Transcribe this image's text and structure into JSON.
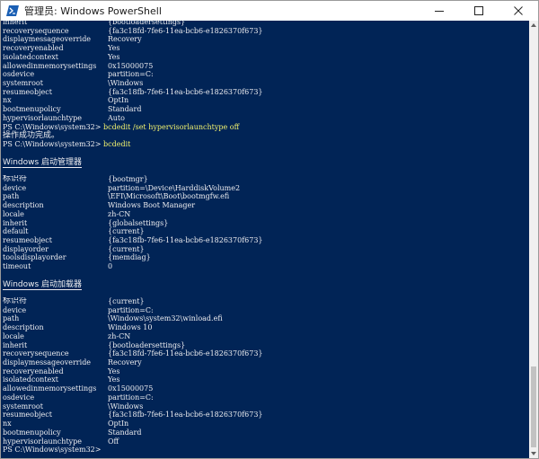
{
  "window": {
    "title": "管理员: Windows PowerShell"
  },
  "console": {
    "lines": [
      {
        "type": "kv",
        "key": "inherit",
        "value": "{bootloadersettings}"
      },
      {
        "type": "kv",
        "key": "recoverysequence",
        "value": "{fa3c18fd-7fe6-11ea-bcb6-e1826370f673}"
      },
      {
        "type": "kv",
        "key": "displaymessageoverride",
        "value": "Recovery"
      },
      {
        "type": "kv",
        "key": "recoveryenabled",
        "value": "Yes"
      },
      {
        "type": "kv",
        "key": "isolatedcontext",
        "value": "Yes"
      },
      {
        "type": "kv",
        "key": "allowedinmemorysettings",
        "value": "0x15000075"
      },
      {
        "type": "kv",
        "key": "osdevice",
        "value": "partition=C:"
      },
      {
        "type": "kv",
        "key": "systemroot",
        "value": "\\Windows"
      },
      {
        "type": "kv",
        "key": "resumeobject",
        "value": "{fa3c18fb-7fe6-11ea-bcb6-e1826370f673}"
      },
      {
        "type": "kv",
        "key": "nx",
        "value": "OptIn"
      },
      {
        "type": "kv",
        "key": "bootmenupolicy",
        "value": "Standard"
      },
      {
        "type": "kv",
        "key": "hypervisorlaunchtype",
        "value": "Auto"
      },
      {
        "type": "prompt",
        "prompt": "PS C:\\Windows\\system32> ",
        "command": "bcdedit /set hypervisorlaunchtype off"
      },
      {
        "type": "text",
        "text": "操作成功完成。"
      },
      {
        "type": "prompt",
        "prompt": "PS C:\\Windows\\system32> ",
        "command": "bcdedit"
      },
      {
        "type": "blank"
      },
      {
        "type": "header",
        "text": "Windows 启动管理器"
      },
      {
        "type": "blank"
      },
      {
        "type": "kv",
        "key": "标识符",
        "value": "{bootmgr}"
      },
      {
        "type": "kv",
        "key": "device",
        "value": "partition=\\Device\\HarddiskVolume2"
      },
      {
        "type": "kv",
        "key": "path",
        "value": "\\EFI\\Microsoft\\Boot\\bootmgfw.efi"
      },
      {
        "type": "kv",
        "key": "description",
        "value": "Windows Boot Manager"
      },
      {
        "type": "kv",
        "key": "locale",
        "value": "zh-CN"
      },
      {
        "type": "kv",
        "key": "inherit",
        "value": "{globalsettings}"
      },
      {
        "type": "kv",
        "key": "default",
        "value": "{current}"
      },
      {
        "type": "kv",
        "key": "resumeobject",
        "value": "{fa3c18fb-7fe6-11ea-bcb6-e1826370f673}"
      },
      {
        "type": "kv",
        "key": "displayorder",
        "value": "{current}"
      },
      {
        "type": "kv",
        "key": "toolsdisplayorder",
        "value": "{memdiag}"
      },
      {
        "type": "kv",
        "key": "timeout",
        "value": "0"
      },
      {
        "type": "blank"
      },
      {
        "type": "header",
        "text": "Windows 启动加载器"
      },
      {
        "type": "blank"
      },
      {
        "type": "kv",
        "key": "标识符",
        "value": "{current}"
      },
      {
        "type": "kv",
        "key": "device",
        "value": "partition=C:"
      },
      {
        "type": "kv",
        "key": "path",
        "value": "\\Windows\\system32\\winload.efi"
      },
      {
        "type": "kv",
        "key": "description",
        "value": "Windows 10"
      },
      {
        "type": "kv",
        "key": "locale",
        "value": "zh-CN"
      },
      {
        "type": "kv",
        "key": "inherit",
        "value": "{bootloadersettings}"
      },
      {
        "type": "kv",
        "key": "recoverysequence",
        "value": "{fa3c18fd-7fe6-11ea-bcb6-e1826370f673}"
      },
      {
        "type": "kv",
        "key": "displaymessageoverride",
        "value": "Recovery"
      },
      {
        "type": "kv",
        "key": "recoveryenabled",
        "value": "Yes"
      },
      {
        "type": "kv",
        "key": "isolatedcontext",
        "value": "Yes"
      },
      {
        "type": "kv",
        "key": "allowedinmemorysettings",
        "value": "0x15000075"
      },
      {
        "type": "kv",
        "key": "osdevice",
        "value": "partition=C:"
      },
      {
        "type": "kv",
        "key": "systemroot",
        "value": "\\Windows"
      },
      {
        "type": "kv",
        "key": "resumeobject",
        "value": "{fa3c18fb-7fe6-11ea-bcb6-e1826370f673}"
      },
      {
        "type": "kv",
        "key": "nx",
        "value": "OptIn"
      },
      {
        "type": "kv",
        "key": "bootmenupolicy",
        "value": "Standard"
      },
      {
        "type": "kv",
        "key": "hypervisorlaunchtype",
        "value": "Off"
      },
      {
        "type": "prompt",
        "prompt": "PS C:\\Windows\\system32> ",
        "command": ""
      }
    ]
  },
  "colors": {
    "console_bg": "#012456",
    "console_fg": "#eeedf0",
    "command_fg": "#f3f36e"
  },
  "icons": {
    "app": "powershell-icon",
    "minimize": "minimize-icon",
    "maximize": "maximize-icon",
    "close": "close-icon"
  }
}
